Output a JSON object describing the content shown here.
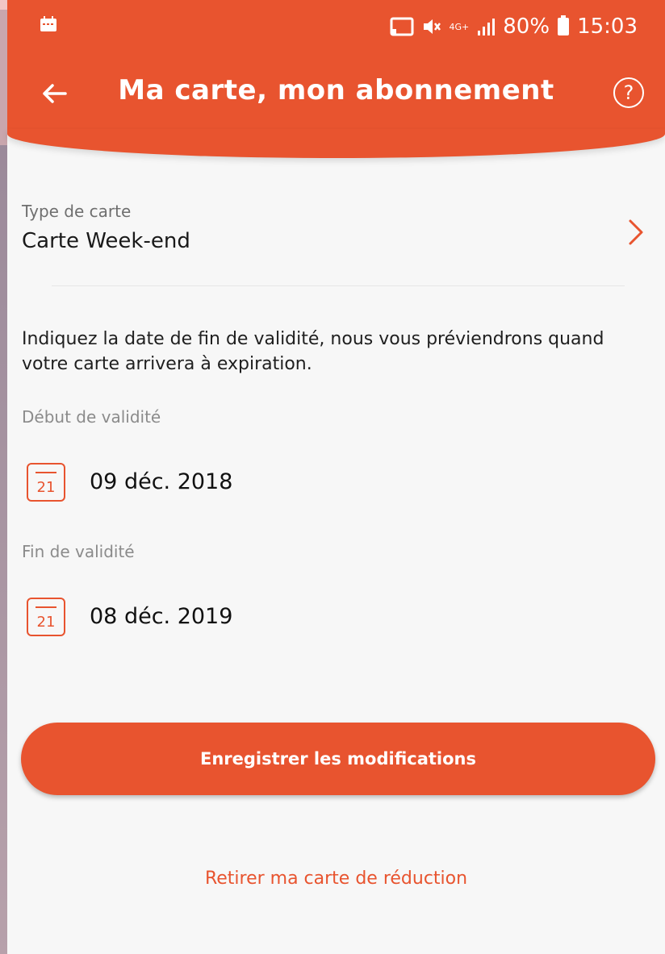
{
  "status_bar": {
    "network": "4G+",
    "battery": "80%",
    "time": "15:03",
    "icons": [
      "calendar-notification-icon",
      "cast-icon",
      "mute-icon",
      "signal-icon",
      "battery-icon"
    ]
  },
  "header": {
    "title": "Ma carte, mon abonnement",
    "help_label": "?"
  },
  "card_type": {
    "label": "Type de carte",
    "value": "Carte Week-end"
  },
  "info_text": "Indiquez la date de fin de validité, nous vous préviendrons quand votre carte arrivera à expiration.",
  "start": {
    "label": "Début de validité",
    "calendar_number": "21",
    "value": "09 déc. 2018"
  },
  "end": {
    "label": "Fin de validité",
    "calendar_number": "21",
    "value": "08 déc. 2019"
  },
  "save_button_label": "Enregistrer les modifications",
  "remove_link_label": "Retirer ma carte de réduction",
  "colors": {
    "accent": "#e8542f",
    "background": "#f7f7f7"
  }
}
